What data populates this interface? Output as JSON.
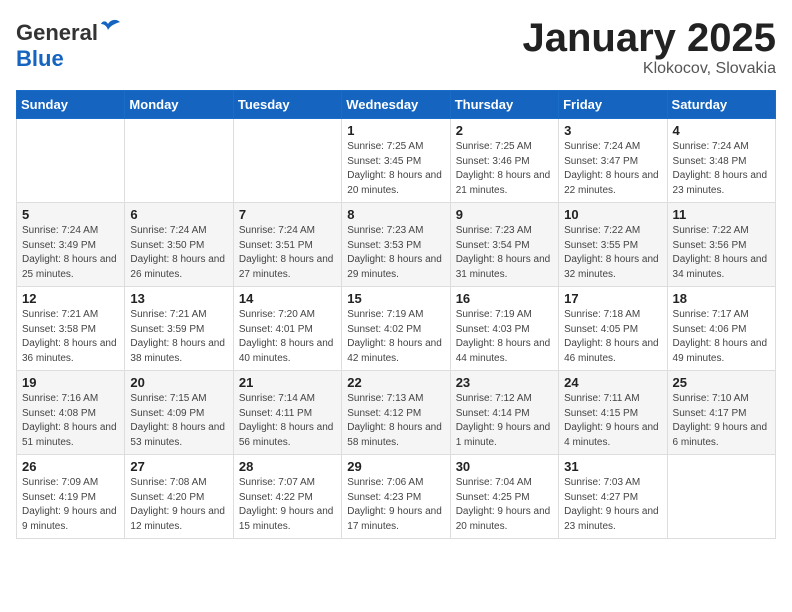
{
  "logo": {
    "general": "General",
    "blue": "Blue"
  },
  "title": {
    "month_year": "January 2025",
    "location": "Klokocov, Slovakia"
  },
  "weekdays": [
    "Sunday",
    "Monday",
    "Tuesday",
    "Wednesday",
    "Thursday",
    "Friday",
    "Saturday"
  ],
  "weeks": [
    [
      {
        "day": "",
        "info": ""
      },
      {
        "day": "",
        "info": ""
      },
      {
        "day": "",
        "info": ""
      },
      {
        "day": "1",
        "info": "Sunrise: 7:25 AM\nSunset: 3:45 PM\nDaylight: 8 hours and 20 minutes."
      },
      {
        "day": "2",
        "info": "Sunrise: 7:25 AM\nSunset: 3:46 PM\nDaylight: 8 hours and 21 minutes."
      },
      {
        "day": "3",
        "info": "Sunrise: 7:24 AM\nSunset: 3:47 PM\nDaylight: 8 hours and 22 minutes."
      },
      {
        "day": "4",
        "info": "Sunrise: 7:24 AM\nSunset: 3:48 PM\nDaylight: 8 hours and 23 minutes."
      }
    ],
    [
      {
        "day": "5",
        "info": "Sunrise: 7:24 AM\nSunset: 3:49 PM\nDaylight: 8 hours and 25 minutes."
      },
      {
        "day": "6",
        "info": "Sunrise: 7:24 AM\nSunset: 3:50 PM\nDaylight: 8 hours and 26 minutes."
      },
      {
        "day": "7",
        "info": "Sunrise: 7:24 AM\nSunset: 3:51 PM\nDaylight: 8 hours and 27 minutes."
      },
      {
        "day": "8",
        "info": "Sunrise: 7:23 AM\nSunset: 3:53 PM\nDaylight: 8 hours and 29 minutes."
      },
      {
        "day": "9",
        "info": "Sunrise: 7:23 AM\nSunset: 3:54 PM\nDaylight: 8 hours and 31 minutes."
      },
      {
        "day": "10",
        "info": "Sunrise: 7:22 AM\nSunset: 3:55 PM\nDaylight: 8 hours and 32 minutes."
      },
      {
        "day": "11",
        "info": "Sunrise: 7:22 AM\nSunset: 3:56 PM\nDaylight: 8 hours and 34 minutes."
      }
    ],
    [
      {
        "day": "12",
        "info": "Sunrise: 7:21 AM\nSunset: 3:58 PM\nDaylight: 8 hours and 36 minutes."
      },
      {
        "day": "13",
        "info": "Sunrise: 7:21 AM\nSunset: 3:59 PM\nDaylight: 8 hours and 38 minutes."
      },
      {
        "day": "14",
        "info": "Sunrise: 7:20 AM\nSunset: 4:01 PM\nDaylight: 8 hours and 40 minutes."
      },
      {
        "day": "15",
        "info": "Sunrise: 7:19 AM\nSunset: 4:02 PM\nDaylight: 8 hours and 42 minutes."
      },
      {
        "day": "16",
        "info": "Sunrise: 7:19 AM\nSunset: 4:03 PM\nDaylight: 8 hours and 44 minutes."
      },
      {
        "day": "17",
        "info": "Sunrise: 7:18 AM\nSunset: 4:05 PM\nDaylight: 8 hours and 46 minutes."
      },
      {
        "day": "18",
        "info": "Sunrise: 7:17 AM\nSunset: 4:06 PM\nDaylight: 8 hours and 49 minutes."
      }
    ],
    [
      {
        "day": "19",
        "info": "Sunrise: 7:16 AM\nSunset: 4:08 PM\nDaylight: 8 hours and 51 minutes."
      },
      {
        "day": "20",
        "info": "Sunrise: 7:15 AM\nSunset: 4:09 PM\nDaylight: 8 hours and 53 minutes."
      },
      {
        "day": "21",
        "info": "Sunrise: 7:14 AM\nSunset: 4:11 PM\nDaylight: 8 hours and 56 minutes."
      },
      {
        "day": "22",
        "info": "Sunrise: 7:13 AM\nSunset: 4:12 PM\nDaylight: 8 hours and 58 minutes."
      },
      {
        "day": "23",
        "info": "Sunrise: 7:12 AM\nSunset: 4:14 PM\nDaylight: 9 hours and 1 minute."
      },
      {
        "day": "24",
        "info": "Sunrise: 7:11 AM\nSunset: 4:15 PM\nDaylight: 9 hours and 4 minutes."
      },
      {
        "day": "25",
        "info": "Sunrise: 7:10 AM\nSunset: 4:17 PM\nDaylight: 9 hours and 6 minutes."
      }
    ],
    [
      {
        "day": "26",
        "info": "Sunrise: 7:09 AM\nSunset: 4:19 PM\nDaylight: 9 hours and 9 minutes."
      },
      {
        "day": "27",
        "info": "Sunrise: 7:08 AM\nSunset: 4:20 PM\nDaylight: 9 hours and 12 minutes."
      },
      {
        "day": "28",
        "info": "Sunrise: 7:07 AM\nSunset: 4:22 PM\nDaylight: 9 hours and 15 minutes."
      },
      {
        "day": "29",
        "info": "Sunrise: 7:06 AM\nSunset: 4:23 PM\nDaylight: 9 hours and 17 minutes."
      },
      {
        "day": "30",
        "info": "Sunrise: 7:04 AM\nSunset: 4:25 PM\nDaylight: 9 hours and 20 minutes."
      },
      {
        "day": "31",
        "info": "Sunrise: 7:03 AM\nSunset: 4:27 PM\nDaylight: 9 hours and 23 minutes."
      },
      {
        "day": "",
        "info": ""
      }
    ]
  ]
}
